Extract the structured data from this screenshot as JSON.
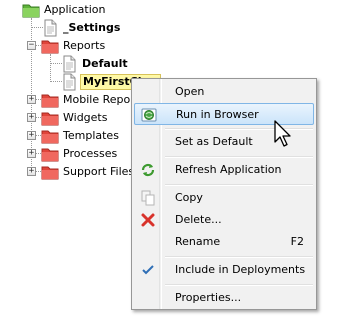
{
  "tree": {
    "root_label": "Application",
    "settings_label": "_Settings",
    "reports_label": "Reports",
    "default_label": "Default",
    "selected_label": "MyFirstChar",
    "mobile_reports_label": "Mobile Reports",
    "widgets_label": "Widgets",
    "templates_label": "Templates",
    "processes_label": "Processes",
    "support_files_label": "Support Files",
    "expander_open": "−",
    "expander_closed": "+"
  },
  "context_menu": {
    "open": "Open",
    "run_in_browser": "Run in Browser",
    "set_as_default": "Set as Default",
    "refresh_application": "Refresh Application",
    "copy": "Copy",
    "delete": "Delete...",
    "rename": "Rename",
    "rename_shortcut": "F2",
    "include_in_deployments": "Include in Deployments",
    "properties": "Properties..."
  },
  "colors": {
    "folder_red": "#e0453b",
    "folder_green": "#5fb33a",
    "selection_fill": "#fff9a6",
    "hover_border": "#80b6e6"
  },
  "icons": [
    "folder-icon",
    "document-icon",
    "globe-icon",
    "refresh-icon",
    "copy-icon",
    "delete-icon",
    "check-icon",
    "mouse-cursor-icon"
  ]
}
